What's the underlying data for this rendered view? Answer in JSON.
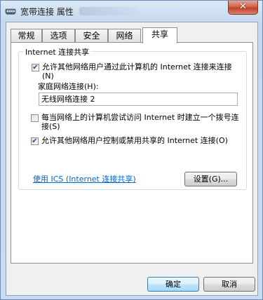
{
  "window": {
    "title": "宽带连接 属性",
    "close_symbol": "✕"
  },
  "tabs": [
    {
      "label": "常规",
      "active": false
    },
    {
      "label": "选项",
      "active": false
    },
    {
      "label": "安全",
      "active": false
    },
    {
      "label": "网络",
      "active": false
    },
    {
      "label": "共享",
      "active": true
    }
  ],
  "sharing": {
    "group_title": "Internet 连接共享",
    "allow_share": {
      "label": "允许其他网络用户通过此计算机的 Internet 连接来连接(N)",
      "checked": true
    },
    "home_network": {
      "label": "家庭网络连接(H):",
      "value": "无线网络连接 2"
    },
    "dial_on_demand": {
      "label": "每当网络上的计算机尝试访问 Internet 时建立一个拨号连接(S)",
      "checked": false
    },
    "allow_control": {
      "label": "允许其他网络用户控制或禁用共享的 Internet 连接(O)",
      "checked": true
    }
  },
  "ics_link": "使用 ICS (Internet 连接共享)",
  "settings_button": "设置(G)...",
  "footer": {
    "ok_label": "确定",
    "cancel_label": "取消"
  },
  "icons": {
    "title_icon": "network-connection-icon",
    "check_mark": "✔"
  },
  "colors": {
    "link": "#0066cc",
    "close_button": "#c1412a",
    "title_bar": "#c6d9ef"
  }
}
